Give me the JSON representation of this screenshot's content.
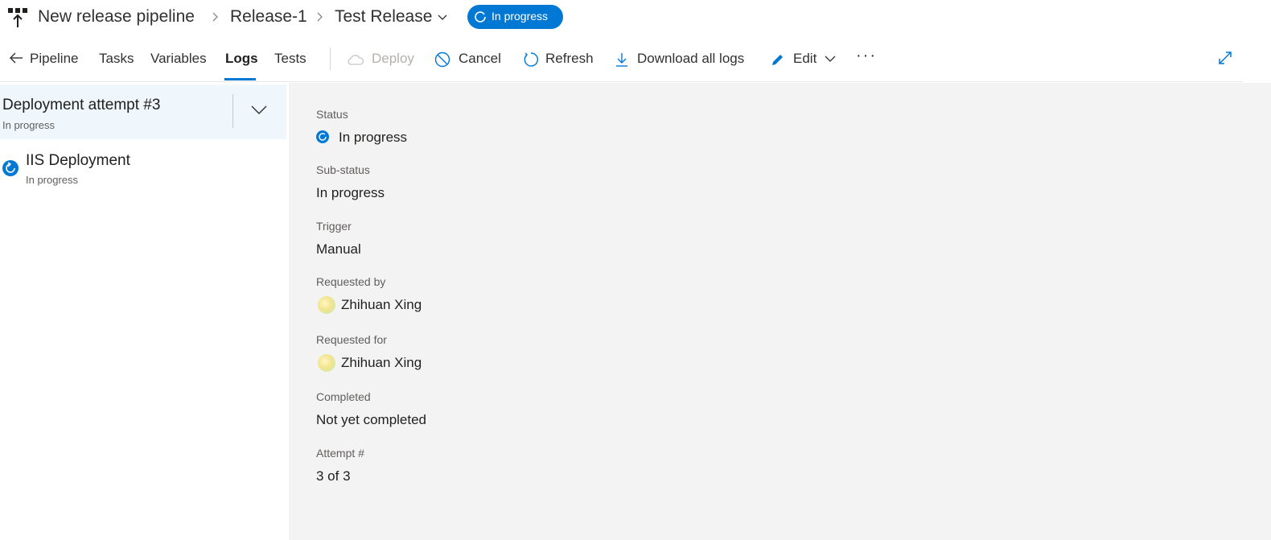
{
  "header": {
    "breadcrumbs": [
      "New release pipeline",
      "Release-1",
      "Test Release"
    ],
    "status_badge": "In progress"
  },
  "toolbar": {
    "back_label": "Pipeline",
    "tabs": [
      {
        "label": "Tasks",
        "active": false
      },
      {
        "label": "Variables",
        "active": false
      },
      {
        "label": "Logs",
        "active": true
      },
      {
        "label": "Tests",
        "active": false
      }
    ],
    "actions": {
      "deploy": "Deploy",
      "cancel": "Cancel",
      "refresh": "Refresh",
      "download": "Download all logs",
      "edit": "Edit",
      "more": "···"
    }
  },
  "left_panel": {
    "attempt": {
      "title": "Deployment attempt #3",
      "status": "In progress"
    },
    "stages": [
      {
        "name": "IIS Deployment",
        "status": "In progress"
      }
    ]
  },
  "details": {
    "status": {
      "label": "Status",
      "value": "In progress"
    },
    "sub_status": {
      "label": "Sub-status",
      "value": "In progress"
    },
    "trigger": {
      "label": "Trigger",
      "value": "Manual"
    },
    "requested_by": {
      "label": "Requested by",
      "value": "Zhihuan Xing"
    },
    "requested_for": {
      "label": "Requested for",
      "value": "Zhihuan Xing"
    },
    "completed": {
      "label": "Completed",
      "value": "Not yet completed"
    },
    "attempt": {
      "label": "Attempt #",
      "value": "3 of 3"
    }
  },
  "colors": {
    "accent": "#0078d4",
    "panel_bg": "#f3f3f3",
    "selected_bg": "#eff6fc"
  }
}
